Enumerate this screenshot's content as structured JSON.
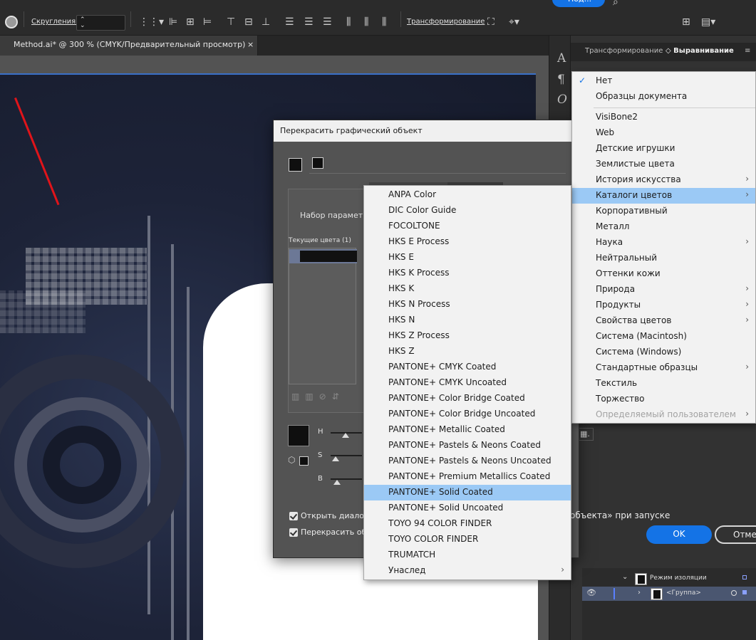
{
  "toolbar": {
    "round_label": "Скругления:",
    "transform_label": "Трансформирование",
    "share_label": "Под..."
  },
  "document": {
    "tab_title": "Method.ai* @ 300 % (CMYK/Предварительный просмотр)",
    "tab_close": "×"
  },
  "panel": {
    "tab_transform": "Трансформирование",
    "tab_align": "Выравнивание",
    "layers": {
      "isolation_label": "Режим изоляции",
      "group_label": "<Группа>"
    }
  },
  "dialog": {
    "title": "Перекрасить графический объект",
    "preset_label": "Набор параметр",
    "current_colors_label": "Текущие цвета (1)",
    "h_label": "H",
    "s_label": "S",
    "b_label": "B",
    "open_dialog_label": "Открыть диалог",
    "recolor_label": "Перекрасить об",
    "on_launch_tail": "объекта» при запуске",
    "ok_label": "OK",
    "cancel_label": "Отмен"
  },
  "library_menu": {
    "items": [
      {
        "label": "Нет",
        "checked": true
      },
      {
        "label": "Образцы документа"
      },
      {
        "label": "VisiBone2"
      },
      {
        "label": "Web"
      },
      {
        "label": "Детские игрушки"
      },
      {
        "label": "Землистые цвета"
      },
      {
        "label": "История искусства",
        "submenu": true
      },
      {
        "label": "Каталоги цветов",
        "submenu": true,
        "highlighted": true
      },
      {
        "label": "Корпоративный"
      },
      {
        "label": "Металл"
      },
      {
        "label": "Наука",
        "submenu": true
      },
      {
        "label": "Нейтральный"
      },
      {
        "label": "Оттенки кожи"
      },
      {
        "label": "Природа",
        "submenu": true
      },
      {
        "label": "Продукты",
        "submenu": true
      },
      {
        "label": "Свойства цветов",
        "submenu": true
      },
      {
        "label": "Система (Macintosh)"
      },
      {
        "label": "Система (Windows)"
      },
      {
        "label": "Стандартные образцы",
        "submenu": true
      },
      {
        "label": "Текстиль"
      },
      {
        "label": "Торжество"
      },
      {
        "label": "Определяемый пользователем",
        "submenu": true,
        "disabled": true
      }
    ]
  },
  "catalog_menu": {
    "items": [
      {
        "label": "ANPA Color"
      },
      {
        "label": "DIC Color Guide"
      },
      {
        "label": "FOCOLTONE"
      },
      {
        "label": "HKS E Process"
      },
      {
        "label": "HKS E"
      },
      {
        "label": "HKS K Process"
      },
      {
        "label": "HKS K"
      },
      {
        "label": "HKS N Process"
      },
      {
        "label": "HKS N"
      },
      {
        "label": "HKS Z Process"
      },
      {
        "label": "HKS Z"
      },
      {
        "label": "PANTONE+ CMYK Coated"
      },
      {
        "label": "PANTONE+ CMYK Uncoated"
      },
      {
        "label": "PANTONE+ Color Bridge Coated"
      },
      {
        "label": "PANTONE+ Color Bridge Uncoated"
      },
      {
        "label": "PANTONE+ Metallic Coated"
      },
      {
        "label": "PANTONE+ Pastels & Neons Coated"
      },
      {
        "label": "PANTONE+ Pastels & Neons Uncoated"
      },
      {
        "label": "PANTONE+ Premium Metallics Coated"
      },
      {
        "label": "PANTONE+ Solid Coated",
        "highlighted": true
      },
      {
        "label": "PANTONE+ Solid Uncoated"
      },
      {
        "label": "TOYO 94 COLOR FINDER"
      },
      {
        "label": "TOYO COLOR FINDER"
      },
      {
        "label": "TRUMATCH"
      },
      {
        "label": "Унаслед",
        "submenu": true
      }
    ]
  },
  "colors": {
    "accent": "#1473e6",
    "menu_highlight": "#9bc9f5",
    "annotation_arrow": "#e0141a"
  }
}
